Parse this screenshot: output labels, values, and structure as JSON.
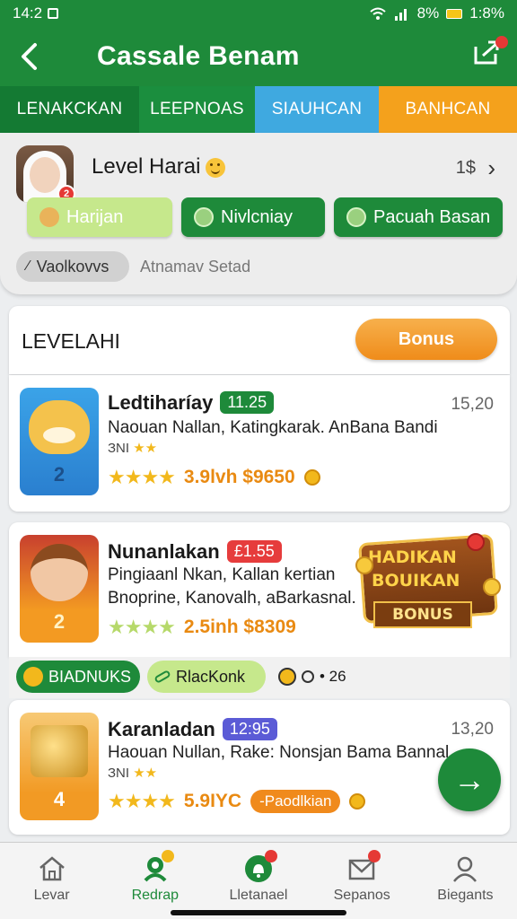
{
  "status_bar": {
    "time": "14:2",
    "battery": "8%",
    "right_text": "1:8%"
  },
  "header": {
    "title": "Cassale Benam"
  },
  "tabs": [
    {
      "label": "LENAKCKAN"
    },
    {
      "label": "LEEPNOAS"
    },
    {
      "label": "SIAUHCAN"
    },
    {
      "label": "BANHCAN"
    }
  ],
  "profile": {
    "level_name": "Level Harai",
    "value": "1$",
    "buttons": [
      {
        "label": "Harijan"
      },
      {
        "label": "Nivlcniay"
      },
      {
        "label": "Pacuah Basan"
      }
    ],
    "tag": "Vaolkovvs",
    "tag_text": "Atnamav Setad"
  },
  "section": {
    "title": "LEVELAHI",
    "bonus_label": "Bonus"
  },
  "items": [
    {
      "title": "Ledtiharíay",
      "badge": "11.25",
      "right": "15,20",
      "desc": "Naouan Nallan, Katingkarak. AnBana Bandi",
      "sub": "ЗNI",
      "sub_stars": "★★",
      "rank": "2",
      "stars": "★★★★",
      "meta_value": "3.9lvh $9650"
    },
    {
      "title": "Nunanlakan",
      "badge": "£1.55",
      "desc_line1": "Pingiaanl Nkan, Kallan kertian",
      "desc_line2": "Bnoprine, Kanovalh, aBarkasnal.",
      "rank": "2",
      "stars": "★★★★",
      "meta_value": "2.5inh $8309"
    },
    {
      "title": "Karanladan",
      "badge": "12:95",
      "right": "13,20",
      "desc": "Haouan Nullan, Rake: Nonsjan Bama Bannal",
      "sub": "ЗNI",
      "sub_stars": "★★",
      "rank": "4",
      "stars": "★★★★",
      "meta_value": "5.9IYC",
      "chip": "-Paodlkian"
    }
  ],
  "promo": {
    "line1": "HADIKAN",
    "line2": "BOUIKAN",
    "line3": "BONUS"
  },
  "actions": [
    {
      "label": "BIADNUKS"
    },
    {
      "label": "RlacKonk"
    }
  ],
  "action_extra": "• 26",
  "fab_icon": "→",
  "bottom_nav": [
    {
      "label": "Levar"
    },
    {
      "label": "Redrap"
    },
    {
      "label": "Lletanael"
    },
    {
      "label": "Sepanos"
    },
    {
      "label": "Biegants"
    }
  ],
  "colors": {
    "primary": "#1e8a3a",
    "accent": "#f08a1c",
    "tab_blue": "#3fa9e0",
    "tab_orange": "#f4a11c"
  }
}
